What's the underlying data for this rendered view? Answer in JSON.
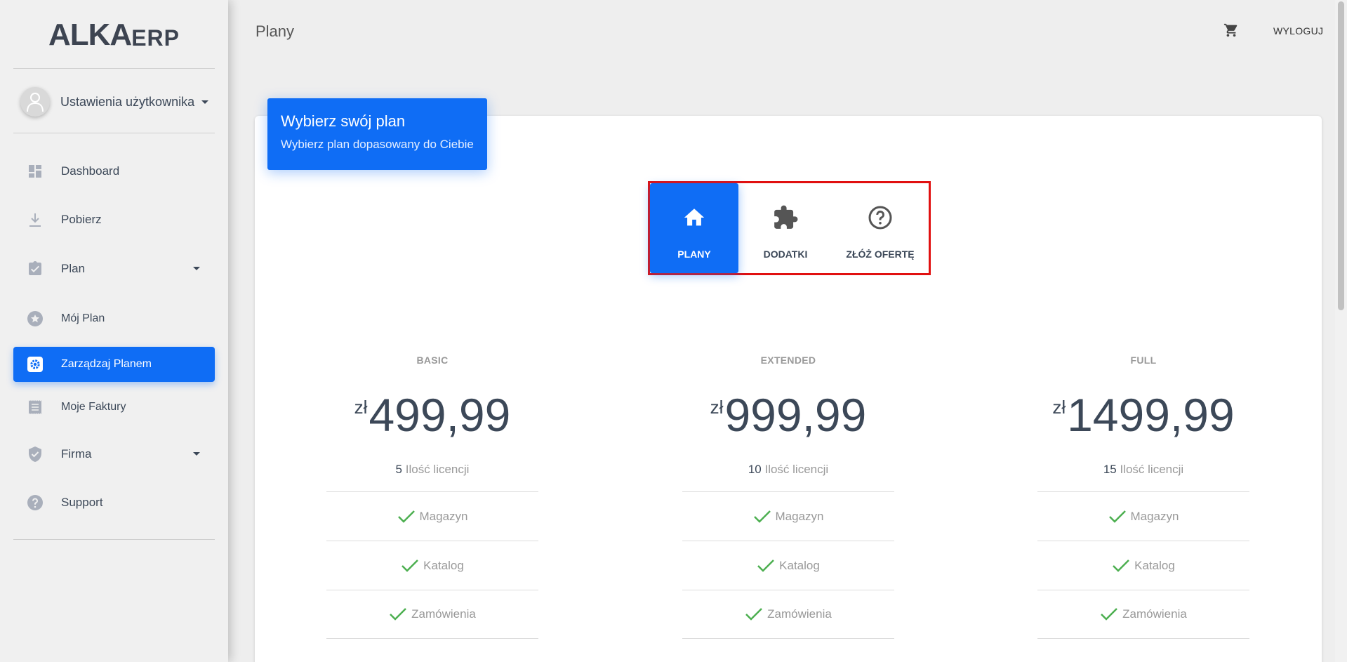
{
  "app": {
    "logo_main": "ALKA",
    "logo_suffix": "ERP"
  },
  "sidebar": {
    "user_label": "Ustawienia użytkownika",
    "items": [
      {
        "label": "Dashboard",
        "icon": "dashboard-icon"
      },
      {
        "label": "Pobierz",
        "icon": "download-icon"
      },
      {
        "label": "Plan",
        "icon": "clipboard-check-icon",
        "expandable": true
      },
      {
        "label": "Mój Plan",
        "icon": "star-icon"
      },
      {
        "label": "Zarządzaj Planem",
        "icon": "gear-icon",
        "active": true
      },
      {
        "label": "Moje Faktury",
        "icon": "receipt-icon"
      },
      {
        "label": "Firma",
        "icon": "shield-check-icon",
        "expandable": true
      },
      {
        "label": "Support",
        "icon": "help-circle-icon"
      }
    ]
  },
  "topbar": {
    "title": "Plany",
    "cart_icon": "cart-icon",
    "logout_label": "WYLOGUJ"
  },
  "card": {
    "header_title": "Wybierz swój plan",
    "header_subtitle": "Wybierz plan dopasowany do Ciebie"
  },
  "tabs": [
    {
      "label": "PLANY",
      "icon": "home-icon",
      "active": true
    },
    {
      "label": "DODATKI",
      "icon": "puzzle-icon"
    },
    {
      "label": "ZŁÓŻ OFERTĘ",
      "icon": "question-circle-icon"
    }
  ],
  "plans": [
    {
      "name": "BASIC",
      "currency": "zł",
      "price": "499,99",
      "licenses": "5",
      "licenses_label": "Ilość licencji",
      "features": [
        "Magazyn",
        "Katalog",
        "Zamówienia"
      ]
    },
    {
      "name": "EXTENDED",
      "currency": "zł",
      "price": "999,99",
      "licenses": "10",
      "licenses_label": "Ilość licencji",
      "features": [
        "Magazyn",
        "Katalog",
        "Zamówienia"
      ]
    },
    {
      "name": "FULL",
      "currency": "zł",
      "price": "1499,99",
      "licenses": "15",
      "licenses_label": "Ilość licencji",
      "features": [
        "Magazyn",
        "Katalog",
        "Zamówienia"
      ]
    }
  ],
  "colors": {
    "accent": "#0f6df5",
    "highlight_border": "#e11010",
    "check": "#4caf50"
  }
}
